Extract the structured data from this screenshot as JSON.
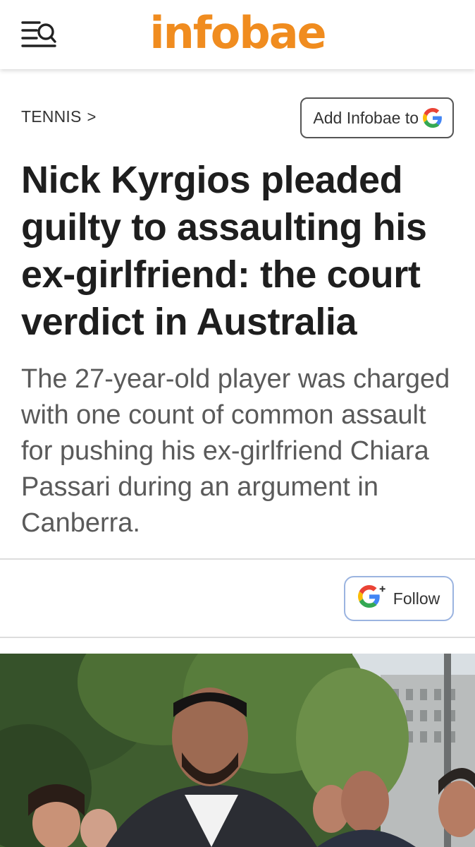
{
  "header": {
    "logo_text": "infobae",
    "menu_icon": "menu-search-icon",
    "brand_color": "#f08c1f"
  },
  "article": {
    "section_label": "TENNIS",
    "section_chevron": ">",
    "add_source_label": "Add Infobae to",
    "headline": "Nick Kyrgios pleaded guilty to assaulting his ex-girlfriend: the court verdict in Australia",
    "subheadline": "The 27-year-old player was charged with one count of common assault for pushing his ex-girlfriend Chiara Passari during an argument in Canberra.",
    "follow_label": "Follow"
  },
  "icons": {
    "google": "google-g-icon",
    "google_plus": "google-plus-icon"
  }
}
